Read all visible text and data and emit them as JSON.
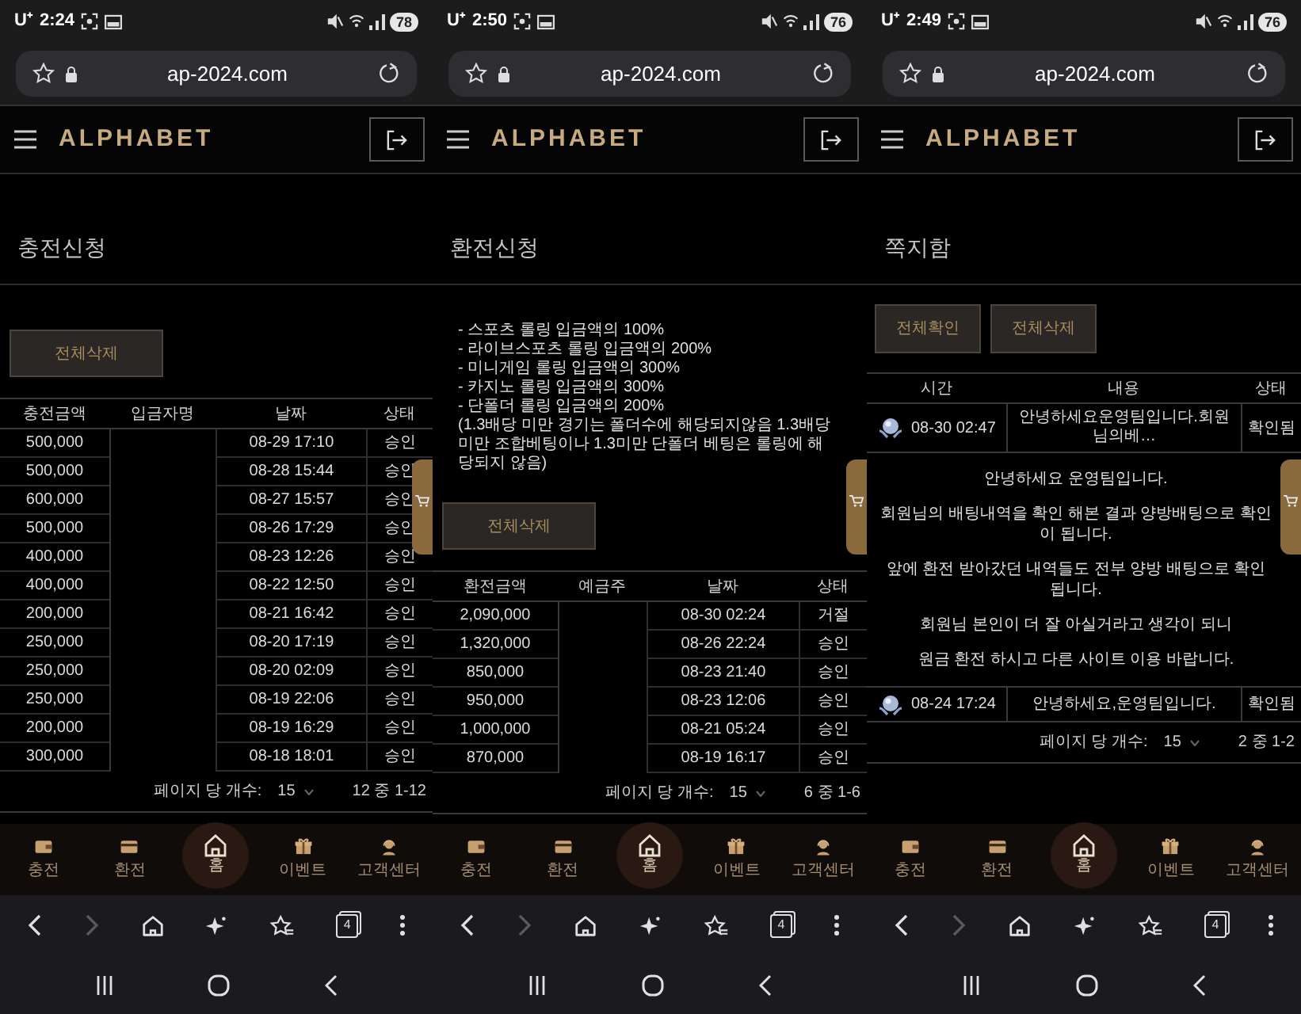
{
  "phones": [
    {
      "status_bar": {
        "carrier": "U⁺",
        "time": "2:24",
        "battery": "78"
      },
      "url": "ap-2024.com",
      "logo": "ALPHABET",
      "page_title": "충전신청",
      "content": {
        "kind": "history",
        "buttons": [
          "전체삭제"
        ],
        "columns": [
          {
            "label": "충전금액"
          },
          {
            "label": "입금자명"
          },
          {
            "label": "날짜"
          },
          {
            "label": "상태"
          }
        ],
        "rows": [
          {
            "amount": "500,000",
            "date": "08-29 17:10",
            "status": "승인"
          },
          {
            "amount": "500,000",
            "date": "08-28 15:44",
            "status": "승인"
          },
          {
            "amount": "600,000",
            "date": "08-27 15:57",
            "status": "승인"
          },
          {
            "amount": "500,000",
            "date": "08-26 17:29",
            "status": "승인"
          },
          {
            "amount": "400,000",
            "date": "08-23 12:26",
            "status": "승인"
          },
          {
            "amount": "400,000",
            "date": "08-22 12:50",
            "status": "승인"
          },
          {
            "amount": "200,000",
            "date": "08-21 16:42",
            "status": "승인"
          },
          {
            "amount": "250,000",
            "date": "08-20 17:19",
            "status": "승인"
          },
          {
            "amount": "250,000",
            "date": "08-20 02:09",
            "status": "승인"
          },
          {
            "amount": "250,000",
            "date": "08-19 22:06",
            "status": "승인"
          },
          {
            "amount": "200,000",
            "date": "08-19 16:29",
            "status": "승인"
          },
          {
            "amount": "300,000",
            "date": "08-18 18:01",
            "status": "승인"
          }
        ],
        "pagination": {
          "label": "페이지 당 개수:",
          "per_page": "15",
          "range": "12 중 1-12"
        }
      },
      "bottom_nav": [
        {
          "kind": "wallet",
          "label": "충전"
        },
        {
          "kind": "card",
          "label": "환전"
        },
        {
          "kind": "home",
          "label": "홈"
        },
        {
          "kind": "gift",
          "label": "이벤트"
        },
        {
          "kind": "headset",
          "label": "고객센터"
        }
      ],
      "browser": {
        "forward_disabled": true,
        "tab_count": "4"
      }
    },
    {
      "status_bar": {
        "carrier": "U⁺",
        "time": "2:50",
        "battery": "76"
      },
      "url": "ap-2024.com",
      "logo": "ALPHABET",
      "page_title": "환전신청",
      "content": {
        "kind": "history",
        "rules": [
          "- 스포츠 롤링 입금액의 100%",
          "- 라이브스포츠 롤링 입금액의 200%",
          "- 미니게임 롤링 입금액의 300%",
          "- 카지노 롤링 입금액의 300%",
          "- 단폴더 롤링 입금액의 200%"
        ],
        "note": "(1.3배당 미만 경기는 폴더수에 해당되지않음 1.3배당 미만 조합베팅이나 1.3미만 단폴더 베팅은 롤링에 해당되지 않음)",
        "buttons": [
          "전체삭제"
        ],
        "columns": [
          {
            "label": "환전금액"
          },
          {
            "label": "예금주"
          },
          {
            "label": "날짜"
          },
          {
            "label": "상태"
          }
        ],
        "rows": [
          {
            "amount": "2,090,000",
            "date": "08-30 02:24",
            "status": "거절"
          },
          {
            "amount": "1,320,000",
            "date": "08-26 22:24",
            "status": "승인"
          },
          {
            "amount": "850,000",
            "date": "08-23 21:40",
            "status": "승인"
          },
          {
            "amount": "950,000",
            "date": "08-23 12:06",
            "status": "승인"
          },
          {
            "amount": "1,000,000",
            "date": "08-21 05:24",
            "status": "승인"
          },
          {
            "amount": "870,000",
            "date": "08-19 16:17",
            "status": "승인"
          }
        ],
        "pagination": {
          "label": "페이지 당 개수:",
          "per_page": "15",
          "range": "6 중 1-6"
        }
      },
      "bottom_nav": [
        {
          "kind": "wallet",
          "label": "충전"
        },
        {
          "kind": "card",
          "label": "환전"
        },
        {
          "kind": "home",
          "label": "홈"
        },
        {
          "kind": "gift",
          "label": "이벤트"
        },
        {
          "kind": "headset",
          "label": "고객센터"
        }
      ],
      "browser": {
        "forward_disabled": true,
        "tab_count": "4"
      }
    },
    {
      "status_bar": {
        "carrier": "U⁺",
        "time": "2:49",
        "battery": "76"
      },
      "url": "ap-2024.com",
      "logo": "ALPHABET",
      "page_title": "쪽지함",
      "content": {
        "kind": "messages",
        "buttons": [
          "전체확인",
          "전체삭제"
        ],
        "columns": [
          {
            "label": "시간"
          },
          {
            "label": "내용"
          },
          {
            "label": "상태"
          }
        ],
        "rows": [
          {
            "time": "08-30 02:47",
            "subject": "안녕하세요운영팀입니다.회원님의베…",
            "status": "확인됨",
            "expanded": true,
            "body": [
              "안녕하세요 운영팀입니다.",
              "회원님의 배팅내역을 확인 해본 결과 양방배팅으로 확인이 됩니다.",
              "앞에 환전 받아갔던 내역들도 전부 양방 배팅으로 확인 됩니다.",
              "회원님 본인이 더 잘 아실거라고 생각이 되니",
              "원금 환전 하시고 다른 사이트 이용 바랍니다."
            ]
          },
          {
            "time": "08-24 17:24",
            "subject": "안녕하세요,운영팀입니다.",
            "status": "확인됨",
            "expanded": false
          }
        ],
        "pagination": {
          "label": "페이지 당 개수:",
          "per_page": "15",
          "range": "2 중 1-2"
        }
      },
      "bottom_nav": [
        {
          "kind": "wallet",
          "label": "충전"
        },
        {
          "kind": "card",
          "label": "환전"
        },
        {
          "kind": "home",
          "label": "홈"
        },
        {
          "kind": "gift",
          "label": "이벤트"
        },
        {
          "kind": "headset",
          "label": "고객센터"
        }
      ],
      "browser": {
        "forward_disabled": true,
        "tab_count": "4"
      }
    }
  ]
}
